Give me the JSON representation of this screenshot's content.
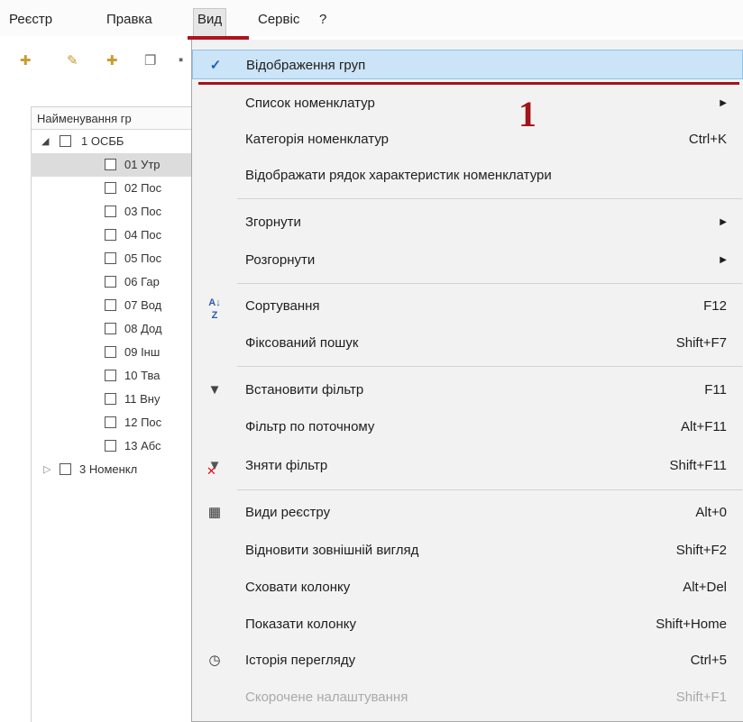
{
  "menubar": {
    "items": [
      {
        "label": "Реєстр"
      },
      {
        "label": "Правка"
      },
      {
        "label": "Вид"
      },
      {
        "label": "Сервіс"
      },
      {
        "label": "?"
      }
    ]
  },
  "colors": {
    "accent_red": "#a11418",
    "highlight": "#cce4f7",
    "menu_bg": "#f2f2f2"
  },
  "annotation": {
    "number": "1"
  },
  "tree": {
    "header": "Найменування гр",
    "rows": [
      {
        "label": "1 ОСББ",
        "expanded": true
      },
      {
        "label": "01 Утр",
        "selected": true
      },
      {
        "label": "02 Пос"
      },
      {
        "label": "03 Пос"
      },
      {
        "label": "04 Пос"
      },
      {
        "label": "05 Пос"
      },
      {
        "label": "06 Гар"
      },
      {
        "label": "07 Вод"
      },
      {
        "label": "08 Дод"
      },
      {
        "label": "09 Інш"
      },
      {
        "label": "10 Тва"
      },
      {
        "label": "11 Вну"
      },
      {
        "label": "12 Пос"
      },
      {
        "label": "13 Абс"
      },
      {
        "label": "3 Номенкл",
        "expanded": false
      }
    ]
  },
  "menu": {
    "items": [
      {
        "label": "Відображення груп",
        "shortcut": "",
        "icon": "checkmark-icon",
        "checked": true
      },
      {
        "label": "Список номенклатур",
        "shortcut": "",
        "submenu": true
      },
      {
        "label": "Категорія номенклатур",
        "shortcut": "Ctrl+K"
      },
      {
        "label": "Відображати рядок характеристик номенклатури",
        "shortcut": ""
      },
      {
        "label": "Згорнути",
        "shortcut": "",
        "submenu": true
      },
      {
        "label": "Розгорнути",
        "shortcut": "",
        "submenu": true
      },
      {
        "label": "Сортування",
        "shortcut": "F12",
        "icon": "sort-az-icon"
      },
      {
        "label": "Фіксований пошук",
        "shortcut": "Shift+F7"
      },
      {
        "label": "Встановити фільтр",
        "shortcut": "F11",
        "icon": "filter-icon"
      },
      {
        "label": "Фільтр по поточному",
        "shortcut": "Alt+F11"
      },
      {
        "label": "Зняти фільтр",
        "shortcut": "Shift+F11",
        "icon": "remove-filter-icon"
      },
      {
        "label": "Види реєстру",
        "shortcut": "Alt+0",
        "icon": "table-icon"
      },
      {
        "label": "Відновити зовнішній вигляд",
        "shortcut": "Shift+F2"
      },
      {
        "label": "Сховати колонку",
        "shortcut": "Alt+Del"
      },
      {
        "label": "Показати колонку",
        "shortcut": "Shift+Home"
      },
      {
        "label": "Історія перегляду",
        "shortcut": "Ctrl+5",
        "icon": "history-icon"
      },
      {
        "label": "Скорочене налаштування",
        "shortcut": "Shift+F1",
        "disabled": true
      }
    ]
  }
}
